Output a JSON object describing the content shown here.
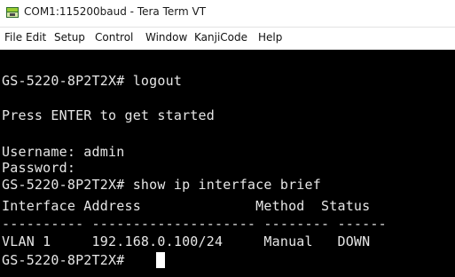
{
  "window": {
    "title": "COM1:115200baud - Tera Term VT"
  },
  "menubar": {
    "items": [
      "File",
      "Edit",
      "Setup",
      "Control",
      "Window",
      "KanjiCode",
      "Help"
    ]
  },
  "terminal": {
    "lines": [
      "GS-5220-8P2T2X# logout",
      "Press ENTER to get started",
      "Username: admin",
      "Password:",
      "GS-5220-8P2T2X# show ip interface brief",
      "Interface Address              Method  Status",
      "---------- -------------------- -------- ------",
      "VLAN 1     192.168.0.100/24     Manual   DOWN",
      "GS-5220-8P2T2X# "
    ]
  },
  "colors": {
    "terminal_bg": "#000000",
    "terminal_fg": "#e6e6e6",
    "cursor": "#ffffff"
  },
  "icons": {
    "app": "tera-term-icon"
  }
}
